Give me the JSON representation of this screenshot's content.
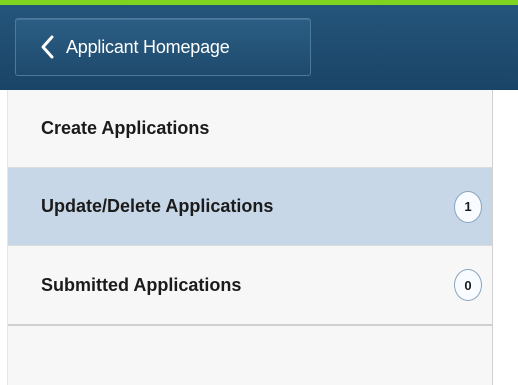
{
  "header": {
    "back_button_label": "Applicant Homepage",
    "back_icon": "chevron-left-icon"
  },
  "colors": {
    "accent": "#7ed321",
    "header_bg": "#1f4b6e",
    "selected_bg": "#c8d7e8"
  },
  "menu": {
    "items": [
      {
        "label": "Create Applications",
        "count": null,
        "selected": false
      },
      {
        "label": "Update/Delete Applications",
        "count": "1",
        "selected": true
      },
      {
        "label": "Submitted Applications",
        "count": "0",
        "selected": false
      }
    ]
  }
}
